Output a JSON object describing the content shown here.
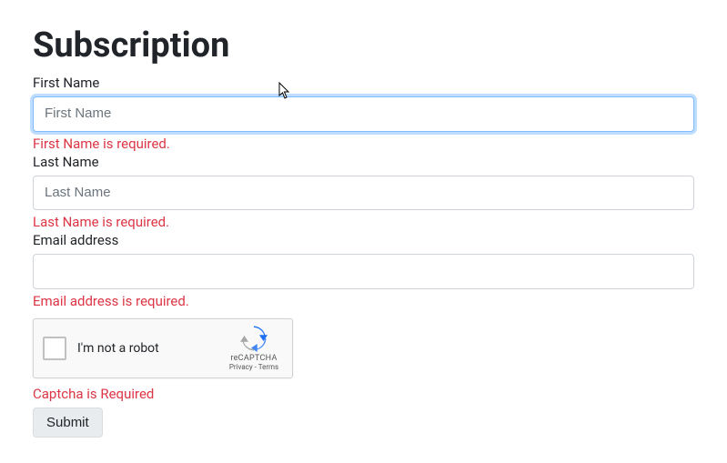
{
  "title": "Subscription",
  "fields": {
    "firstName": {
      "label": "First Name",
      "placeholder": "First Name",
      "value": "",
      "error": "First Name is required."
    },
    "lastName": {
      "label": "Last Name",
      "placeholder": "Last Name",
      "value": "",
      "error": "Last Name is required."
    },
    "email": {
      "label": "Email address",
      "placeholder": "",
      "value": "",
      "error": "Email address is required."
    }
  },
  "recaptcha": {
    "label": "I'm not a robot",
    "brand": "reCAPTCHA",
    "privacy": "Privacy",
    "terms": "Terms",
    "separator": " - "
  },
  "captchaError": "Captcha is Required",
  "submitLabel": "Submit"
}
